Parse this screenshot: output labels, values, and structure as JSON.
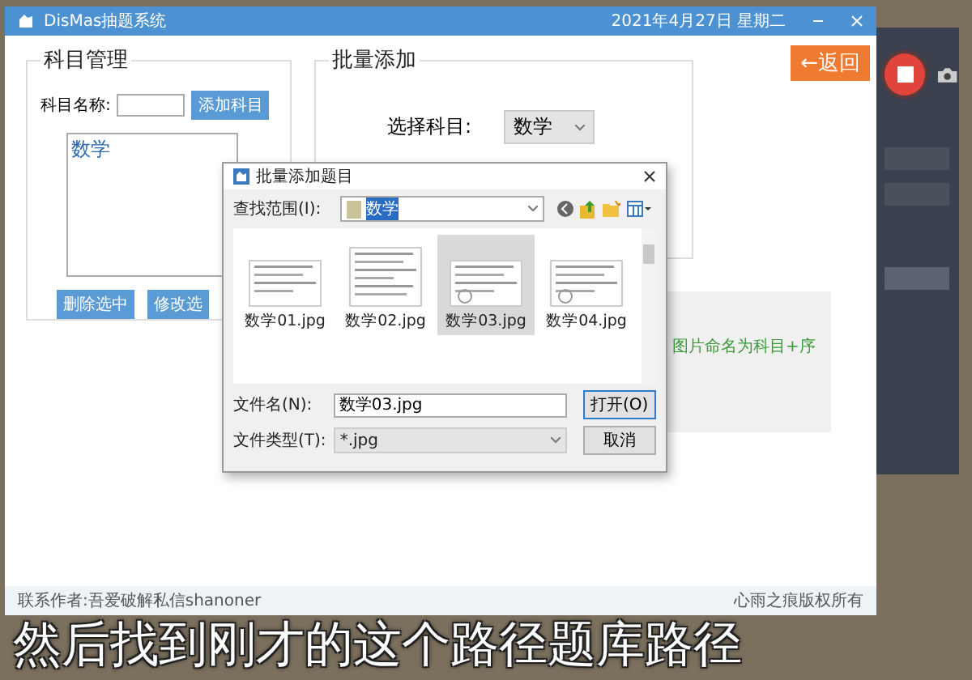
{
  "main_window": {
    "title": "DisMas抽题系统",
    "date": "2021年4月27日 星期二",
    "back_button": "←返回"
  },
  "subject_panel": {
    "title": "科目管理",
    "name_label": "科目名称:",
    "add_button": "添加科目",
    "subjects": [
      {
        "label": "数学",
        "selected": false
      }
    ],
    "delete_button": "删除选中",
    "edit_button": "修改选"
  },
  "batch_panel": {
    "title": "批量添加",
    "subject_label": "选择科目:",
    "subject_value": "数学"
  },
  "hint": "图片命名为科目+序",
  "status_bar": {
    "left": "联系作者:吾爱破解私信shanoner",
    "right": "心雨之痕版权所有"
  },
  "dialog": {
    "title": "批量添加题目",
    "look_in_label": "查找范围(I):",
    "look_in_value": "数学",
    "files": [
      {
        "name": "数学01.jpg",
        "selected": false
      },
      {
        "name": "数学02.jpg",
        "selected": false
      },
      {
        "name": "数学03.jpg",
        "selected": true
      },
      {
        "name": "数学04.jpg",
        "selected": false
      }
    ],
    "file_name_label": "文件名(N):",
    "file_name_value": "数学03.jpg",
    "file_type_label": "文件类型(T):",
    "file_type_value": "*.jpg",
    "open_button": "打开(O)",
    "cancel_button": "取消"
  },
  "subtitle": "然后找到刚才的这个路径题库路径"
}
